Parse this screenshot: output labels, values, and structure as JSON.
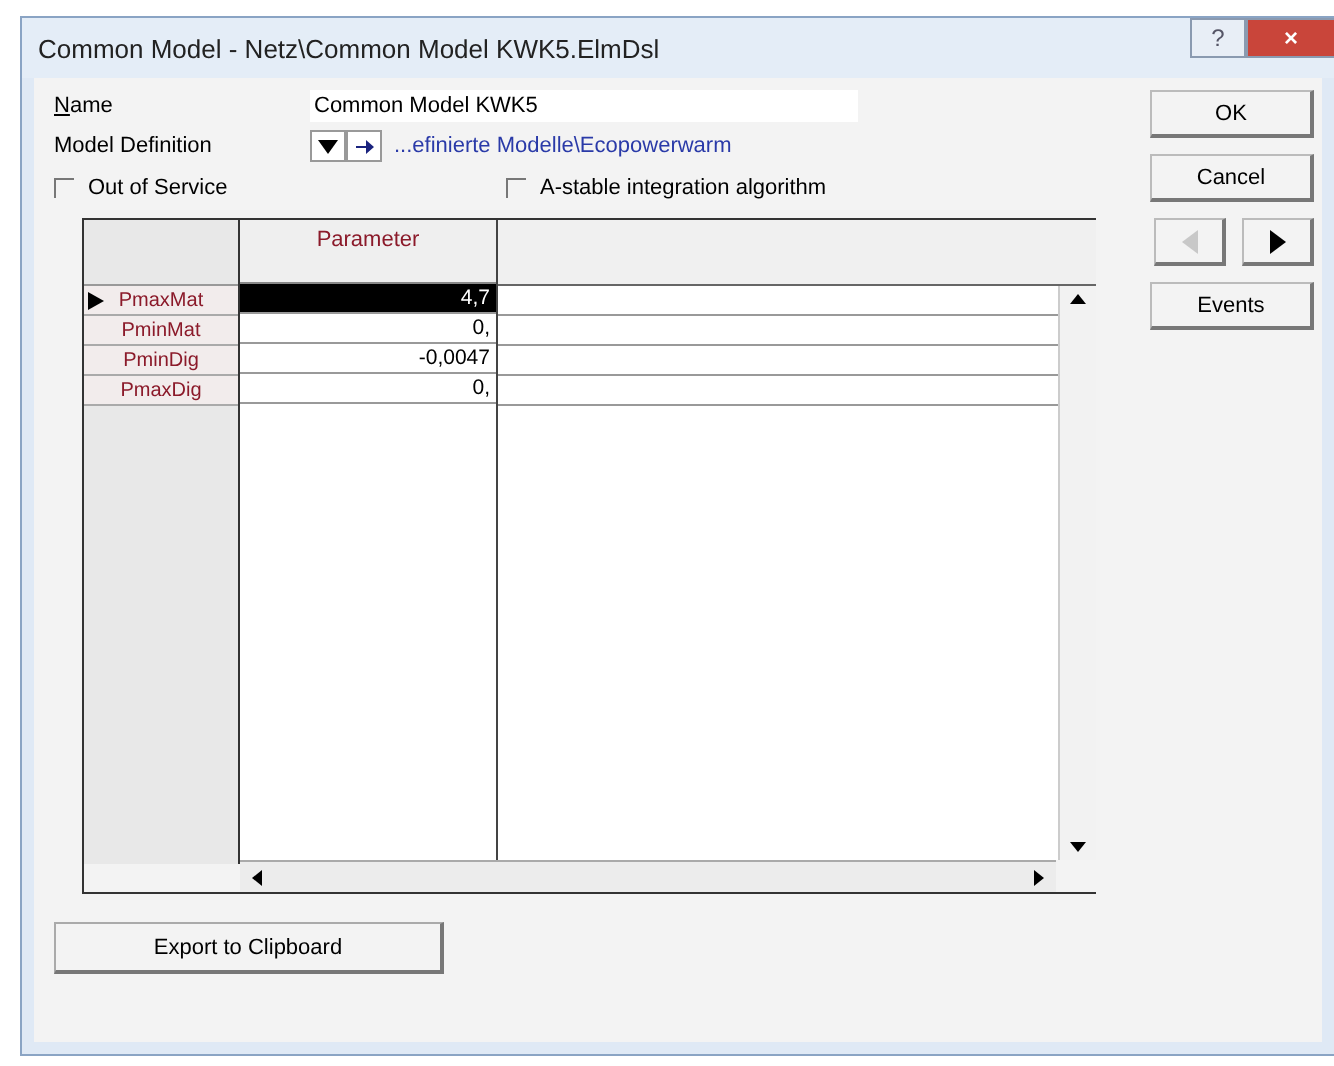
{
  "window": {
    "title": "Common Model - Netz\\Common Model KWK5.ElmDsl",
    "controls": [
      "?",
      "×"
    ]
  },
  "name_field": {
    "label": "Name",
    "value": "Common Model KWK5"
  },
  "model_definition": {
    "label": "Model Definition",
    "link": "...efinierte Modelle\\Ecopowerwarm"
  },
  "checkboxes": [
    {
      "label": "Out of Service",
      "checked": false
    },
    {
      "label": "A-stable integration algorithm",
      "checked": false
    }
  ],
  "table": {
    "columns": [
      "Parameter"
    ],
    "rows": [
      {
        "name": "PmaxMat",
        "value": "4,7",
        "selected": true
      },
      {
        "name": "PminMat",
        "value": "0,",
        "selected": false
      },
      {
        "name": "PminDig",
        "value": "-0,0047",
        "selected": false
      },
      {
        "name": "PmaxDig",
        "value": "0,",
        "selected": false
      }
    ]
  },
  "buttons": [
    "OK",
    "Cancel"
  ],
  "nav": {
    "prev_disabled": true,
    "next_disabled": false
  },
  "events_button": "Events",
  "export_button": "Export to Clipboard"
}
